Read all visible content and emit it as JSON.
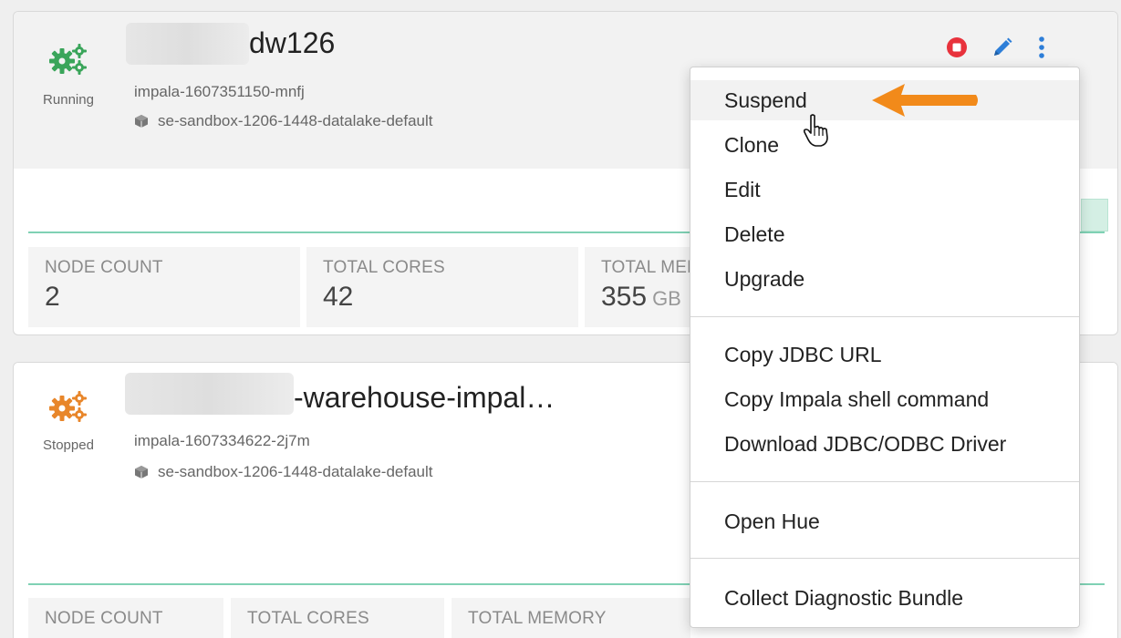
{
  "warehouses": [
    {
      "status": "Running",
      "name_visible": "dw126",
      "instance_id": "impala-1607351150-mnfj",
      "environment": "se-sandbox-1206-1448-datalake-default",
      "metrics": [
        {
          "label": "NODE COUNT",
          "value": "2",
          "unit": ""
        },
        {
          "label": "TOTAL CORES",
          "value": "42",
          "unit": ""
        },
        {
          "label": "TOTAL MEM",
          "value": "355",
          "unit": "GB"
        }
      ]
    },
    {
      "status": "Stopped",
      "name_visible": "-warehouse-impal…",
      "instance_id": "impala-1607334622-2j7m",
      "environment": "se-sandbox-1206-1448-datalake-default",
      "metrics": [
        {
          "label": "NODE COUNT"
        },
        {
          "label": "TOTAL CORES"
        },
        {
          "label": "TOTAL MEMORY"
        }
      ]
    }
  ],
  "actions_menu": {
    "groups": [
      [
        "Suspend",
        "Clone",
        "Edit",
        "Delete",
        "Upgrade"
      ],
      [
        "Copy JDBC URL",
        "Copy Impala shell command",
        "Download JDBC/ODBC Driver"
      ],
      [
        "Open Hue"
      ],
      [
        "Collect Diagnostic Bundle"
      ]
    ],
    "hovered_item": "Suspend"
  },
  "icons": {
    "running_status": "gears-icon",
    "stopped_status": "gears-icon",
    "environment": "cube-icon",
    "stop": "stop-circle-icon",
    "edit": "pencil-icon",
    "more": "vertical-ellipsis-icon",
    "annotation": "arrow-left-icon",
    "cursor": "hand-pointer-icon"
  },
  "colors": {
    "running_green": "#3aa55a",
    "stopped_orange": "#e8862a",
    "stop_red": "#e8323c",
    "edit_blue": "#2d7ed8",
    "annotation_orange": "#f28a1a",
    "progress_teal": "#7fd1b4"
  }
}
